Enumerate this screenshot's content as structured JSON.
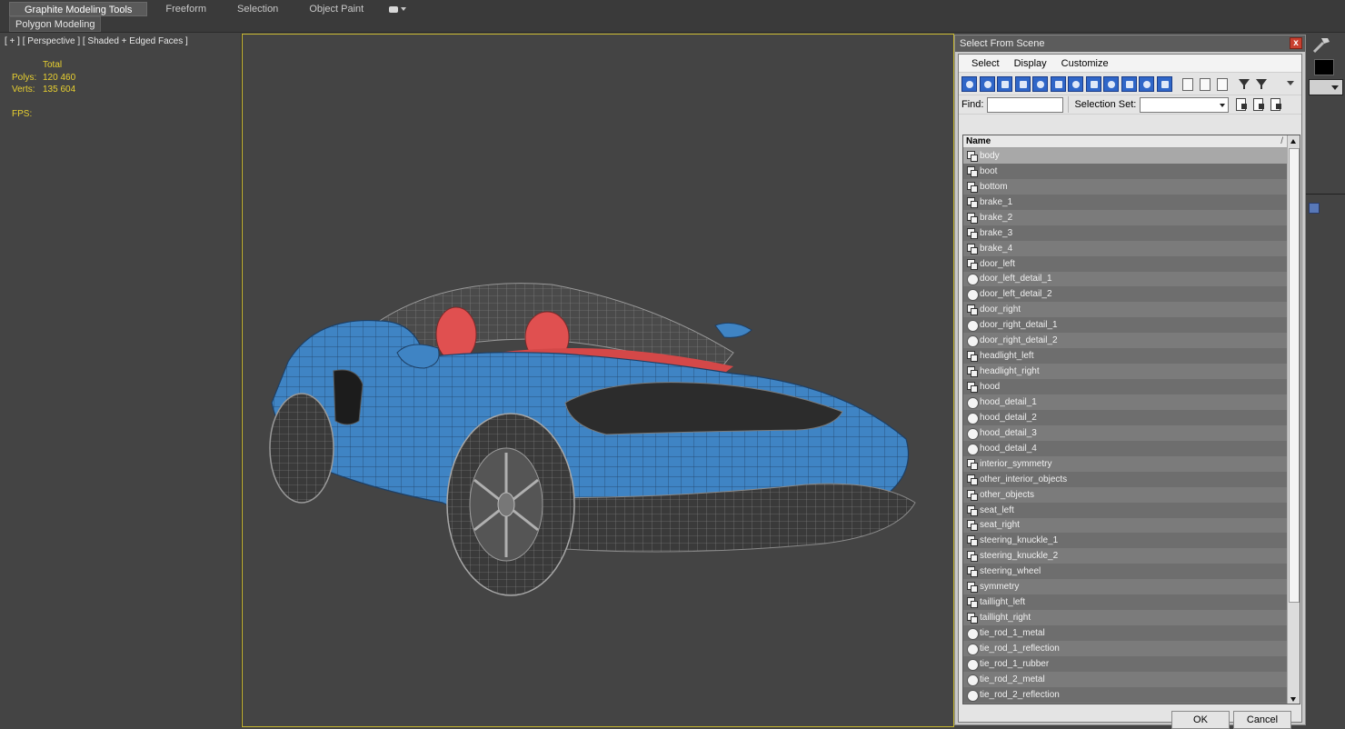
{
  "ribbon": {
    "tabs": [
      {
        "label": "Graphite Modeling Tools",
        "active": true
      },
      {
        "label": "Freeform",
        "active": false
      },
      {
        "label": "Selection",
        "active": false
      },
      {
        "label": "Object Paint",
        "active": false
      }
    ],
    "subtab": "Polygon Modeling"
  },
  "left_viewport": {
    "label": "[ + ] [ Perspective ] [ Shaded + Edged Faces ]",
    "stats": {
      "total_label": "Total",
      "polys_label": "Polys:",
      "polys_value": "120 460",
      "verts_label": "Verts:",
      "verts_value": "135 604",
      "fps_label": "FPS:"
    }
  },
  "dialog": {
    "title": "Select From Scene",
    "close_glyph": "x",
    "menu": [
      "Select",
      "Display",
      "Customize"
    ],
    "find_label": "Find:",
    "find_value": "",
    "selection_set_label": "Selection Set:",
    "selection_set_value": "",
    "column_header": "Name",
    "sort_indicator": "/",
    "objects": [
      {
        "name": "body",
        "icon": "mesh-icon"
      },
      {
        "name": "boot",
        "icon": "mesh-icon"
      },
      {
        "name": "bottom",
        "icon": "mesh-icon"
      },
      {
        "name": "brake_1",
        "icon": "mesh-icon"
      },
      {
        "name": "brake_2",
        "icon": "mesh-icon"
      },
      {
        "name": "brake_3",
        "icon": "mesh-icon"
      },
      {
        "name": "brake_4",
        "icon": "mesh-icon"
      },
      {
        "name": "door_left",
        "icon": "mesh-icon"
      },
      {
        "name": "door_left_detail_1",
        "icon": "sphere-icon"
      },
      {
        "name": "door_left_detail_2",
        "icon": "sphere-icon"
      },
      {
        "name": "door_right",
        "icon": "mesh-icon"
      },
      {
        "name": "door_right_detail_1",
        "icon": "sphere-icon"
      },
      {
        "name": "door_right_detail_2",
        "icon": "sphere-icon"
      },
      {
        "name": "headlight_left",
        "icon": "mesh-icon"
      },
      {
        "name": "headlight_right",
        "icon": "mesh-icon"
      },
      {
        "name": "hood",
        "icon": "mesh-icon"
      },
      {
        "name": "hood_detail_1",
        "icon": "sphere-icon"
      },
      {
        "name": "hood_detail_2",
        "icon": "sphere-icon"
      },
      {
        "name": "hood_detail_3",
        "icon": "sphere-icon"
      },
      {
        "name": "hood_detail_4",
        "icon": "sphere-icon"
      },
      {
        "name": "interior_symmetry",
        "icon": "mesh-icon"
      },
      {
        "name": "other_interior_objects",
        "icon": "mesh-icon"
      },
      {
        "name": "other_objects",
        "icon": "mesh-icon"
      },
      {
        "name": "seat_left",
        "icon": "mesh-icon"
      },
      {
        "name": "seat_right",
        "icon": "mesh-icon"
      },
      {
        "name": "steering_knuckle_1",
        "icon": "mesh-icon"
      },
      {
        "name": "steering_knuckle_2",
        "icon": "mesh-icon"
      },
      {
        "name": "steering_wheel",
        "icon": "mesh-icon"
      },
      {
        "name": "symmetry",
        "icon": "mesh-icon"
      },
      {
        "name": "taillight_left",
        "icon": "mesh-icon"
      },
      {
        "name": "taillight_right",
        "icon": "mesh-icon"
      },
      {
        "name": "tie_rod_1_metal",
        "icon": "sphere-icon"
      },
      {
        "name": "tie_rod_1_reflection",
        "icon": "sphere-icon"
      },
      {
        "name": "tie_rod_1_rubber",
        "icon": "sphere-icon"
      },
      {
        "name": "tie_rod_2_metal",
        "icon": "sphere-icon"
      },
      {
        "name": "tie_rod_2_reflection",
        "icon": "sphere-icon"
      }
    ],
    "ok_label": "OK",
    "cancel_label": "Cancel"
  },
  "colors": {
    "stats_text": "#e8d030",
    "viewport_border": "#c8b830",
    "car_body": "#3f84c4",
    "car_interior": "#e05050"
  }
}
